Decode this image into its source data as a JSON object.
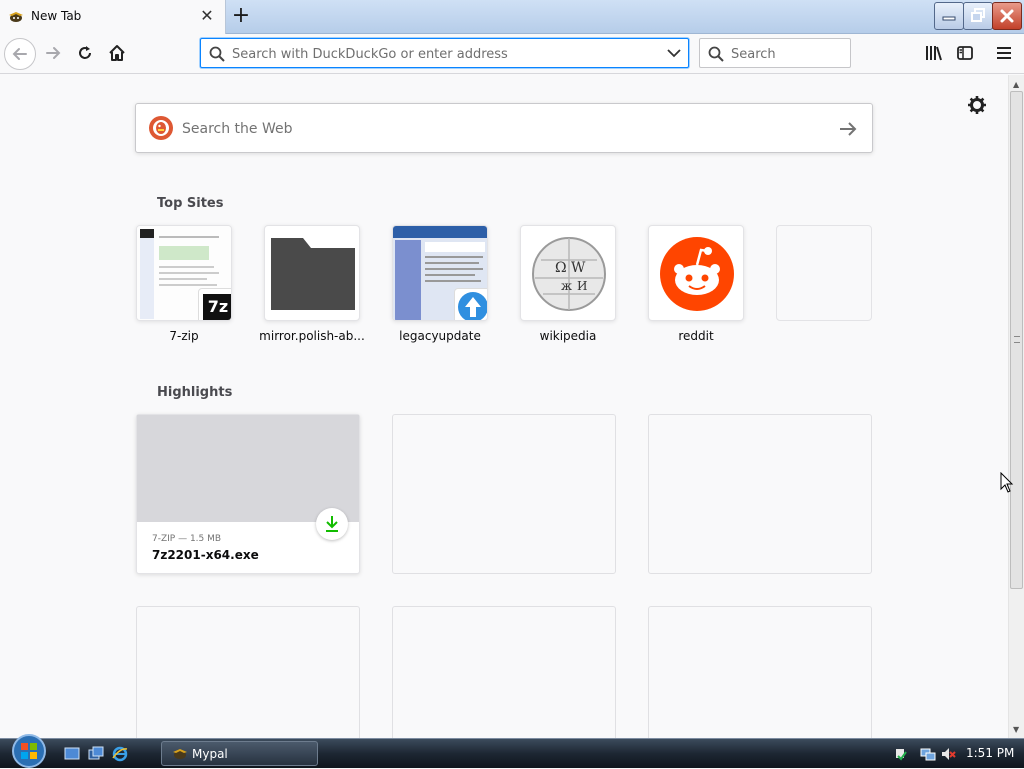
{
  "tab": {
    "title": "New Tab",
    "favicon": "mypal-icon"
  },
  "window_controls": {
    "minimize": "minimize-icon",
    "maximize": "restore-icon",
    "close": "close-icon"
  },
  "toolbar": {
    "url_placeholder": "Search with DuckDuckGo or enter address",
    "search_placeholder": "Search"
  },
  "newtab": {
    "websearch_placeholder": "Search the Web",
    "top_sites_title": "Top Sites",
    "top_sites": [
      {
        "label": "7-zip"
      },
      {
        "label": "mirror.polish-ab..."
      },
      {
        "label": "legacyupdate"
      },
      {
        "label": "wikipedia"
      },
      {
        "label": "reddit"
      },
      {
        "label": ""
      }
    ],
    "highlights_title": "Highlights",
    "highlight": {
      "context": "7-ZIP — 1.5 MB",
      "filename": "7z2201-x64.exe"
    }
  },
  "taskbar": {
    "task_label": "Mypal",
    "clock": "1:51 PM"
  },
  "colors": {
    "accent": "#0a84ff",
    "reddit": "#ff4500",
    "download_green": "#12bc00"
  }
}
